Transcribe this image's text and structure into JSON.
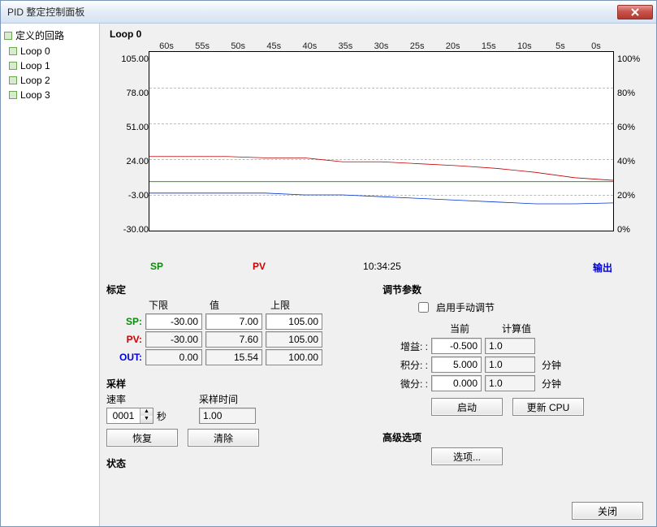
{
  "window": {
    "title": "PID 整定控制面板"
  },
  "sidebar": {
    "header": "定义的回路",
    "items": [
      "Loop 0",
      "Loop 1",
      "Loop 2",
      "Loop 3"
    ]
  },
  "loop_title": "Loop 0",
  "chart_data": {
    "type": "line",
    "xlabel_ticks": [
      "60s",
      "55s",
      "50s",
      "45s",
      "40s",
      "35s",
      "30s",
      "25s",
      "20s",
      "15s",
      "10s",
      "5s",
      "0s"
    ],
    "y_left_ticks": [
      "105.00",
      "78.00",
      "51.00",
      "24.00",
      "-3.00",
      "-30.00"
    ],
    "y_right_ticks": [
      "100%",
      "80%",
      "60%",
      "40%",
      "20%",
      "0%"
    ],
    "ylim_left": [
      -30,
      105
    ],
    "ylim_right": [
      0,
      100
    ],
    "timestamp": "10:34:25",
    "legend": {
      "sp": "SP",
      "pv": "PV",
      "out": "输出"
    },
    "series": [
      {
        "name": "SP",
        "color": "#0a8a0a",
        "values": [
          7,
          7,
          7,
          7,
          7,
          7,
          7,
          7,
          7,
          7,
          7,
          7,
          7
        ]
      },
      {
        "name": "PV",
        "color": "#c00000",
        "values": [
          26,
          26,
          26,
          25,
          25,
          22,
          22,
          20.5,
          19,
          17,
          14,
          10,
          8
        ]
      },
      {
        "name": "OUT_pct",
        "color": "#0030d0",
        "values": [
          21,
          21,
          21,
          21,
          20,
          20,
          19,
          18,
          17,
          16,
          15,
          15,
          15.5
        ]
      }
    ]
  },
  "scaling": {
    "title": "标定",
    "cols": {
      "lo": "下限",
      "val": "值",
      "hi": "上限"
    },
    "sp": {
      "label": "SP:",
      "lo": "-30.00",
      "val": "7.00",
      "hi": "105.00"
    },
    "pv": {
      "label": "PV:",
      "lo": "-30.00",
      "val": "7.60",
      "hi": "105.00"
    },
    "out": {
      "label": "OUT:",
      "lo": "0.00",
      "val": "15.54",
      "hi": "100.00"
    }
  },
  "tuning": {
    "title": "调节参数",
    "manual_label": "启用手动调节",
    "cols": {
      "cur": "当前",
      "calc": "计算值"
    },
    "gain": {
      "label": "增益: :",
      "cur": "-0.500",
      "calc": "1.0"
    },
    "integ": {
      "label": "积分: :",
      "cur": "5.000",
      "calc": "1.0",
      "unit": "分钟"
    },
    "deriv": {
      "label": "微分: :",
      "cur": "0.000",
      "calc": "1.0",
      "unit": "分钟"
    },
    "start_btn": "启动",
    "update_btn": "更新 CPU"
  },
  "sampling": {
    "title": "采样",
    "rate_label": "速率",
    "rate_val": "0001",
    "rate_unit": "秒",
    "time_label": "采样时间",
    "time_val": "1.00",
    "resume_btn": "恢复",
    "clear_btn": "清除"
  },
  "advanced": {
    "title": "高级选项",
    "options_btn": "选项..."
  },
  "status": {
    "title": "状态"
  },
  "close_btn": "关闭"
}
